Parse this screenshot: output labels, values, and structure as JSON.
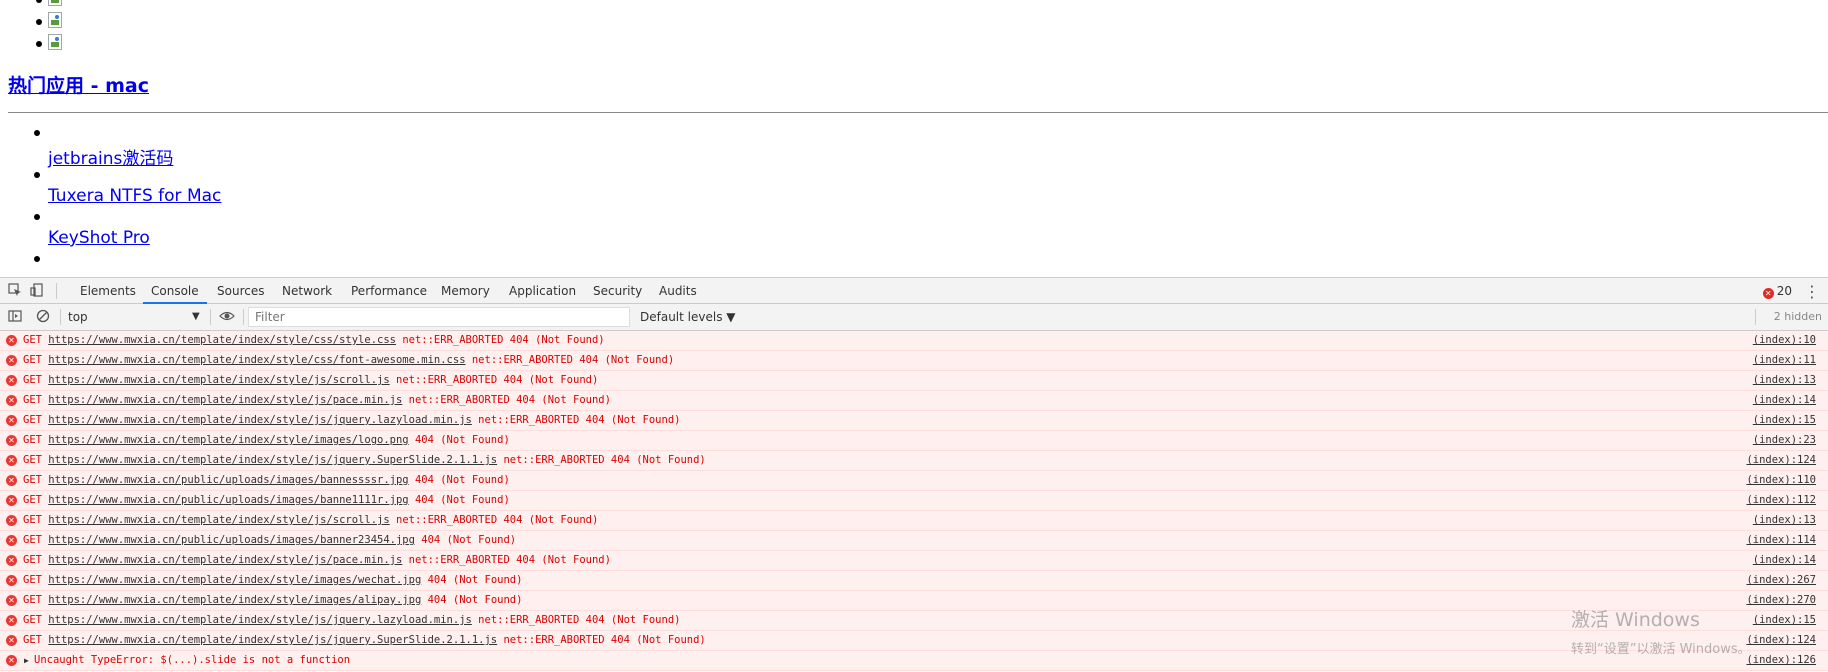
{
  "page": {
    "section_title": "热门应用 - mac",
    "links": [
      "jetbrains激活码",
      "Tuxera NTFS for Mac",
      "KeyShot Pro"
    ]
  },
  "devtools": {
    "tabs": [
      "Elements",
      "Console",
      "Sources",
      "Network",
      "Performance",
      "Memory",
      "Application",
      "Security",
      "Audits"
    ],
    "active_tab": "Console",
    "error_count": "20",
    "toolbar": {
      "context": "top",
      "filter_placeholder": "Filter",
      "levels": "Default levels ▼",
      "hidden": "2 hidden"
    },
    "messages": [
      {
        "method": "GET",
        "url": "https://www.mwxia.cn/template/index/style/css/style.css",
        "msg": "net::ERR_ABORTED 404 (Not Found)",
        "src": "(index):10"
      },
      {
        "method": "GET",
        "url": "https://www.mwxia.cn/template/index/style/css/font-awesome.min.css",
        "msg": "net::ERR_ABORTED 404 (Not Found)",
        "src": "(index):11"
      },
      {
        "method": "GET",
        "url": "https://www.mwxia.cn/template/index/style/js/scroll.js",
        "msg": "net::ERR_ABORTED 404 (Not Found)",
        "src": "(index):13"
      },
      {
        "method": "GET",
        "url": "https://www.mwxia.cn/template/index/style/js/pace.min.js",
        "msg": "net::ERR_ABORTED 404 (Not Found)",
        "src": "(index):14"
      },
      {
        "method": "GET",
        "url": "https://www.mwxia.cn/template/index/style/js/jquery.lazyload.min.js",
        "msg": "net::ERR_ABORTED 404 (Not Found)",
        "src": "(index):15"
      },
      {
        "method": "GET",
        "url": "https://www.mwxia.cn/template/index/style/images/logo.png",
        "msg": "404 (Not Found)",
        "src": "(index):23"
      },
      {
        "method": "GET",
        "url": "https://www.mwxia.cn/template/index/style/js/jquery.SuperSlide.2.1.1.js",
        "msg": "net::ERR_ABORTED 404 (Not Found)",
        "src": "(index):124"
      },
      {
        "method": "GET",
        "url": "https://www.mwxia.cn/public/uploads/images/bannessssr.jpg",
        "msg": "404 (Not Found)",
        "src": "(index):110"
      },
      {
        "method": "GET",
        "url": "https://www.mwxia.cn/public/uploads/images/banne1111r.jpg",
        "msg": "404 (Not Found)",
        "src": "(index):112"
      },
      {
        "method": "GET",
        "url": "https://www.mwxia.cn/template/index/style/js/scroll.js",
        "msg": "net::ERR_ABORTED 404 (Not Found)",
        "src": "(index):13"
      },
      {
        "method": "GET",
        "url": "https://www.mwxia.cn/public/uploads/images/banner23454.jpg",
        "msg": "404 (Not Found)",
        "src": "(index):114"
      },
      {
        "method": "GET",
        "url": "https://www.mwxia.cn/template/index/style/js/pace.min.js",
        "msg": "net::ERR_ABORTED 404 (Not Found)",
        "src": "(index):14"
      },
      {
        "method": "GET",
        "url": "https://www.mwxia.cn/template/index/style/images/wechat.jpg",
        "msg": "404 (Not Found)",
        "src": "(index):267"
      },
      {
        "method": "GET",
        "url": "https://www.mwxia.cn/template/index/style/images/alipay.jpg",
        "msg": "404 (Not Found)",
        "src": "(index):270"
      },
      {
        "method": "GET",
        "url": "https://www.mwxia.cn/template/index/style/js/jquery.lazyload.min.js",
        "msg": "net::ERR_ABORTED 404 (Not Found)",
        "src": "(index):15"
      },
      {
        "method": "GET",
        "url": "https://www.mwxia.cn/template/index/style/js/jquery.SuperSlide.2.1.1.js",
        "msg": "net::ERR_ABORTED 404 (Not Found)",
        "src": "(index):124"
      }
    ],
    "uncaught": {
      "text": "Uncaught TypeError: $(...).slide is not a function",
      "src": "(index):126"
    }
  },
  "watermark": {
    "line1": "激活 Windows",
    "line2": "转到“设置”以激活 Windows。"
  },
  "colors": {
    "error_red": "#d00000",
    "error_bg": "#fff0f0",
    "active_tab": "#1a73e8",
    "link": "#0000ee"
  }
}
